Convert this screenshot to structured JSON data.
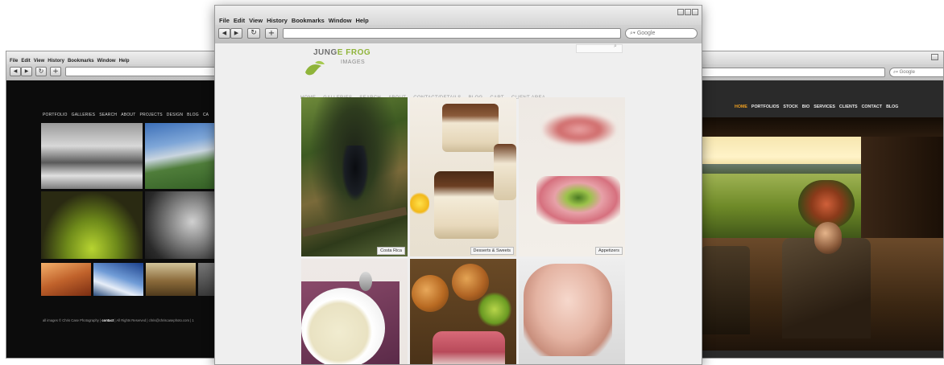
{
  "browser": {
    "menu": [
      "File",
      "Edit",
      "View",
      "History",
      "Bookmarks",
      "Window",
      "Help"
    ],
    "search_placeholder": "Google",
    "nav_icons": [
      "back-arrow-icon",
      "forward-arrow-icon",
      "reload-icon",
      "add-bookmark-icon"
    ]
  },
  "left_site": {
    "nav": [
      "PORTFOLIO",
      "GALLERIES",
      "SEARCH",
      "ABOUT",
      "PROJECTS",
      "DESIGN",
      "BLOG",
      "CA"
    ],
    "footer_prefix": "all images © Chris Case Photography  |",
    "footer_contact": "contact",
    "footer_suffix": "|  All Rights Reserved  |  chris@chriscasephoto.com  |  1"
  },
  "center_site": {
    "logo_line1_a": "JUNG",
    "logo_line1_b": "E FROG",
    "logo_line2": "IMAGES",
    "nav": [
      "HOME",
      "GALLERIES",
      "SEARCH",
      "ABOUT",
      "CONTACT/DETAILS",
      "BLOG",
      "CART",
      "CLIENT AREA"
    ],
    "galleries": [
      {
        "caption": "Costa Rica"
      },
      {
        "caption": "Desserts & Sweets"
      },
      {
        "caption": "Appetizers"
      }
    ]
  },
  "right_site": {
    "nav": [
      "HOME",
      "PORTFOLIOS",
      "STOCK",
      "BIO",
      "SERVICES",
      "CLIENTS",
      "CONTACT",
      "BLOG"
    ],
    "active_nav": "HOME"
  },
  "colors": {
    "logo_green": "#8fb43a",
    "right_nav_active": "#f0a020",
    "left_bg": "#0c0c0c",
    "center_bg": "#efefef"
  }
}
